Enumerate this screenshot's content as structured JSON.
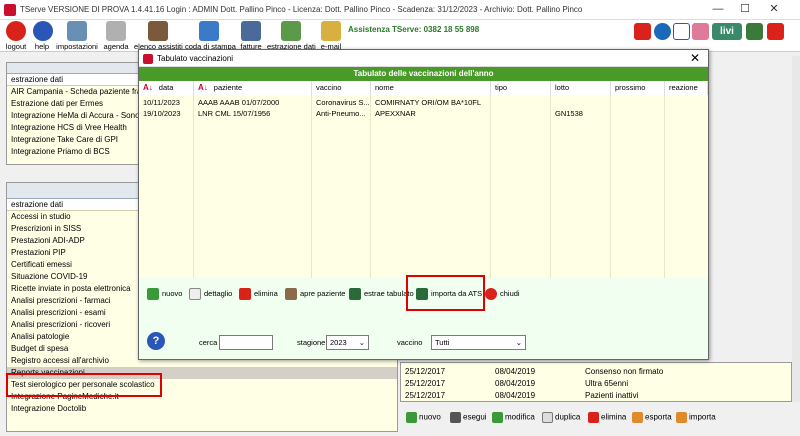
{
  "app": {
    "title": "TServe VERSIONE DI PROVA 1.4.41.16  Login : ADMIN Dott. Pallino Pinco - Licenza: Dott. Pallino Pinco - Scadenza: 31/12/2023 - Archivio: Dott. Pallino Pinco",
    "min": "—",
    "max": "☐",
    "close": "✕"
  },
  "toolbar": {
    "items": [
      "logout",
      "help",
      "impostazioni",
      "agenda",
      "elenco assistiti",
      "coda di stampa",
      "fatture",
      "estrazione dati",
      "e-mail"
    ],
    "assist": "Assistenza TServe: 0382 18 55 898",
    "livi": "livi"
  },
  "left_top": {
    "header": "estrazione dati",
    "items": [
      "AIR Campania - Scheda paziente fragi",
      "Estrazione dati per Ermes",
      "Integrazione HeMa di Accura - Sono",
      "Integrazione HCS di Vree Health",
      "Integrazione Take Care di GPI",
      "Integrazione Priamo di BCS"
    ]
  },
  "left_bottom": {
    "header": "estrazione dati",
    "items": [
      "Accessi in studio",
      "Prescrizioni in SISS",
      "Prestazioni ADI-ADP",
      "Prestazioni PIP",
      "Certificati emessi",
      "Situazione COVID-19",
      "Ricette inviate in posta elettronica",
      "Analisi prescrizioni - farmaci",
      "Analisi prescrizioni - esami",
      "Analisi prescrizioni - ricoveri",
      "Analisi patologie",
      "Budget di spesa",
      "Registro accessi all'archivio",
      "Reports vaccinazioni",
      "Test sierologico per personale scolastico",
      "Integrazione PagineMediche.it",
      "Integrazione Doctolib"
    ]
  },
  "right_rows": [
    [
      "25/12/2017",
      "08/04/2019",
      "Consenso non firmato"
    ],
    [
      "25/12/2017",
      "08/04/2019",
      "Ultra 65enni"
    ],
    [
      "25/12/2017",
      "08/04/2019",
      "Pazienti inattivi"
    ]
  ],
  "right_tools": [
    "nuovo",
    "esegui",
    "modifica",
    "duplica",
    "elimina",
    "esporta",
    "importa"
  ],
  "dialog": {
    "title": "Tabulato vaccinazioni",
    "close": "✕",
    "header": "Tabulato delle vaccinazioni dell'anno",
    "columns": [
      "data",
      "paziente",
      "vaccino",
      "nome",
      "tipo",
      "lotto",
      "prossimo",
      "reazione"
    ],
    "rows": [
      [
        "10/11/2023",
        "AAAB AAAB 01/07/2000",
        "Coronavirus S...",
        "COMIRNATY ORI/OM BA*10FL",
        "",
        "",
        "",
        ""
      ],
      [
        "19/10/2023",
        "LNR CML 15/07/1956",
        "Anti-Pneumo...",
        "APEXXNAR",
        "",
        "GN1538",
        "",
        ""
      ]
    ],
    "buttons": [
      "nuovo",
      "dettaglio",
      "elimina",
      "apre paziente",
      "estrae tabulato",
      "importa da ATS",
      "chiudi"
    ],
    "cerca_label": "cerca",
    "cerca_value": "",
    "stagione_label": "stagione",
    "stagione_value": "2023",
    "vaccino_label": "vaccino",
    "vaccino_value": "Tutti",
    "help": "?"
  }
}
